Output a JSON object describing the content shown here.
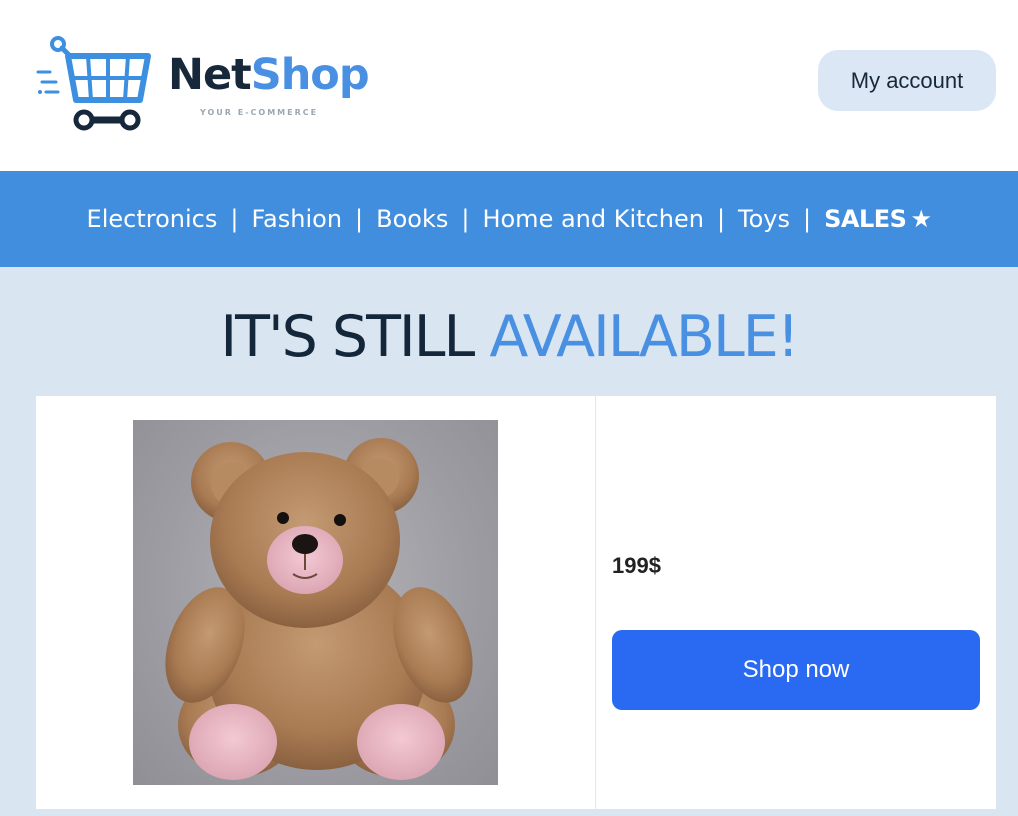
{
  "header": {
    "logo": {
      "name_part1": "Net",
      "name_part2": "Shop",
      "tagline": "YOUR E-COMMERCE",
      "icon": "shopping-cart-icon",
      "colors": {
        "dark": "#17283a",
        "blue": "#4a90e2"
      }
    },
    "account_button": "My account"
  },
  "nav": {
    "items": [
      "Electronics",
      "Fashion",
      "Books",
      "Home and Kitchen",
      "Toys"
    ],
    "separator": "|",
    "sales": {
      "label": "SALES",
      "icon": "star-icon",
      "glyph": "★"
    },
    "background": "#418edf"
  },
  "main": {
    "headline_part1": "IT'S STILL",
    "headline_part2": "AVAILABLE!",
    "product": {
      "image": "teddy-bear-image",
      "price": "199$",
      "cta": "Shop now",
      "cta_color": "#2a6af2"
    },
    "background": "#d9e6f1"
  }
}
